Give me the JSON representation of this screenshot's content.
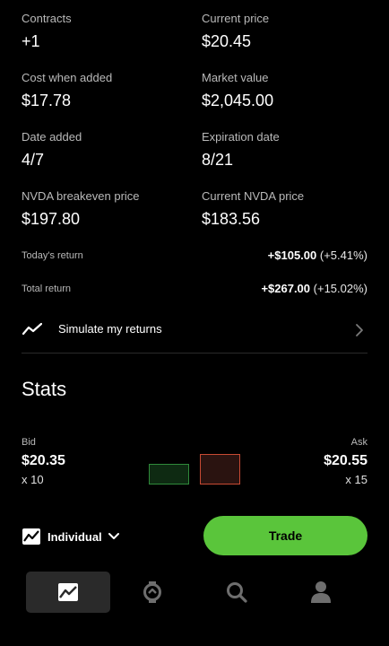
{
  "details": {
    "contracts_label": "Contracts",
    "contracts_value": "+1",
    "current_price_label": "Current price",
    "current_price_value": "$20.45",
    "cost_label": "Cost when added",
    "cost_value": "$17.78",
    "market_value_label": "Market value",
    "market_value_value": "$2,045.00",
    "date_added_label": "Date added",
    "date_added_value": "4/7",
    "expiration_label": "Expiration date",
    "expiration_value": "8/21",
    "breakeven_label": "NVDA breakeven price",
    "breakeven_value": "$197.80",
    "current_nvda_label": "Current NVDA price",
    "current_nvda_value": "$183.56"
  },
  "returns": {
    "today_label": "Today's return",
    "today_amount": "+$105.00",
    "today_pct": "(+5.41%)",
    "total_label": "Total return",
    "total_amount": "+$267.00",
    "total_pct": "(+15.02%)"
  },
  "simulate": {
    "label": "Simulate my returns"
  },
  "stats": {
    "title": "Stats",
    "bid_label": "Bid",
    "bid_value": "$20.35",
    "bid_qty": "x 10",
    "ask_label": "Ask",
    "ask_value": "$20.55",
    "ask_qty": "x 15"
  },
  "footer": {
    "account_label": "Individual",
    "trade_label": "Trade"
  },
  "nav": {
    "items": [
      "chart-icon",
      "options-icon",
      "search-icon",
      "account-icon"
    ]
  },
  "colors": {
    "accent": "#5ac53b",
    "bid_box_border": "#2f8a3a",
    "bid_box_fill": "#0e2a12",
    "ask_box_border": "#c74a33",
    "ask_box_fill": "#2a1310"
  }
}
